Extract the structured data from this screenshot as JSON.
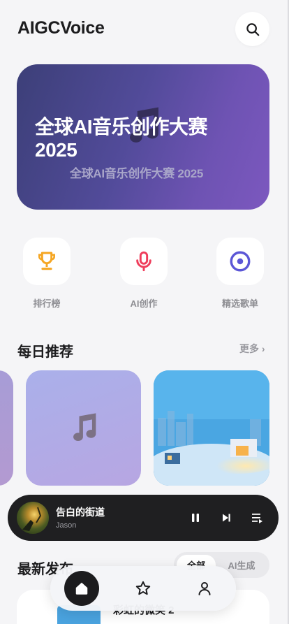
{
  "app": {
    "title": "AIGCVoice"
  },
  "banner": {
    "title": "全球AI音乐创作大赛 2025",
    "subtitle": "全球AI音乐创作大赛 2025"
  },
  "quick_actions": [
    {
      "label": "排行榜",
      "icon": "trophy-icon",
      "color": "#f5a623"
    },
    {
      "label": "AI创作",
      "icon": "microphone-icon",
      "color": "#ef3d5b"
    },
    {
      "label": "精选歌单",
      "icon": "disc-icon",
      "color": "#5b56d6"
    }
  ],
  "daily": {
    "title": "每日推荐",
    "more": "更多 ›"
  },
  "player": {
    "song": "告白的街道",
    "artist": "Jason",
    "controls": [
      "pause-icon",
      "next-icon",
      "playlist-icon"
    ]
  },
  "latest": {
    "title": "最新发布",
    "tabs": [
      "全部",
      "AI生成"
    ],
    "first_item_title": "彩虹的微笑 2"
  },
  "nav": {
    "items": [
      "home-icon",
      "star-icon",
      "profile-icon"
    ]
  },
  "colors": {
    "background": "#f5f5f7",
    "banner_start": "#3c3f78",
    "banner_end": "#7c58bf",
    "player_bg": "#1f1f21",
    "accent_dark": "#1c1c1e"
  }
}
